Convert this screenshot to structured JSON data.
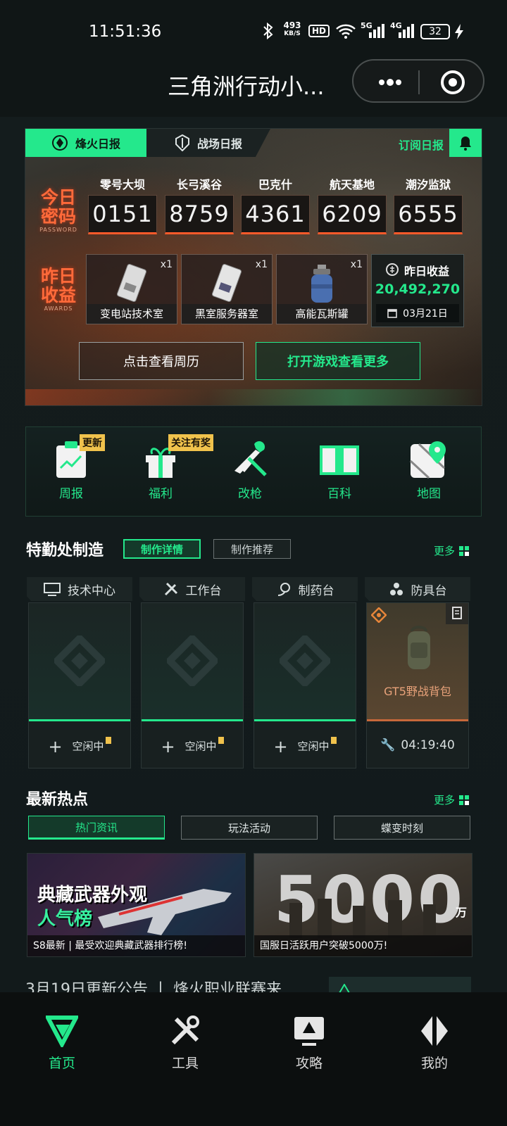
{
  "status": {
    "time": "11:51:36",
    "net_speed": "493",
    "net_unit": "KB/S",
    "hd": "HD",
    "sig1": "5G",
    "sig2": "4G",
    "battery": "32"
  },
  "title": {
    "text": "三角洲行动小..."
  },
  "daily": {
    "tab_active": "烽火日报",
    "tab_other": "战场日报",
    "subscribe": "订阅日报",
    "password_title": "今日密码",
    "password_sub": "PASSWORD",
    "awards_title": "昨日收益",
    "awards_sub": "AWARDS",
    "maps": [
      {
        "name": "零号大坝",
        "code": "0151"
      },
      {
        "name": "长弓溪谷",
        "code": "8759"
      },
      {
        "name": "巴克什",
        "code": "4361"
      },
      {
        "name": "航天基地",
        "code": "6209"
      },
      {
        "name": "潮汐监狱",
        "code": "6555"
      }
    ],
    "items": [
      {
        "name": "变电站技术室",
        "count": "x1"
      },
      {
        "name": "黑室服务器室",
        "count": "x1"
      },
      {
        "name": "高能瓦斯罐",
        "count": "x1"
      }
    ],
    "earnings_label": "昨日收益",
    "earnings_value": "20,492,270",
    "earnings_date": "03月21日",
    "btn_calendar": "点击查看周历",
    "btn_open_game": "打开游戏查看更多"
  },
  "tools": [
    {
      "label": "周报",
      "badge": "更新"
    },
    {
      "label": "福利",
      "badge": "关注有奖"
    },
    {
      "label": "改枪",
      "badge": ""
    },
    {
      "label": "百科",
      "badge": ""
    },
    {
      "label": "地图",
      "badge": ""
    }
  ],
  "craft": {
    "title": "特勤处制造",
    "chip_active": "制作详情",
    "chip_other": "制作推荐",
    "more": "更多",
    "stations": [
      {
        "name": "技术中心",
        "status": "空闲中"
      },
      {
        "name": "工作台",
        "status": "空闲中"
      },
      {
        "name": "制药台",
        "status": "空闲中"
      },
      {
        "name": "防具台",
        "item": "GT5野战背包",
        "timer": "04:19:40"
      }
    ]
  },
  "news": {
    "title": "最新热点",
    "more": "更多",
    "tabs": [
      "热门资讯",
      "玩法活动",
      "蝶变时刻"
    ],
    "banners": [
      {
        "headline1": "典藏武器外观",
        "headline2": "人气榜",
        "caption": "S8最新 | 最受欢迎典藏武器排行榜!"
      },
      {
        "headline1": "5000",
        "headline2": "万",
        "caption": "国服日活跃用户突破5000万!"
      }
    ],
    "list_title": "3月19日更新公告 丨 烽火职业联赛来"
  },
  "nav": [
    {
      "label": "首页",
      "active": true
    },
    {
      "label": "工具",
      "active": false
    },
    {
      "label": "攻略",
      "active": false
    },
    {
      "label": "我的",
      "active": false
    }
  ],
  "colors": {
    "accent": "#24e88c",
    "danger": "#ff5a2a",
    "badge": "#f0c24c"
  }
}
